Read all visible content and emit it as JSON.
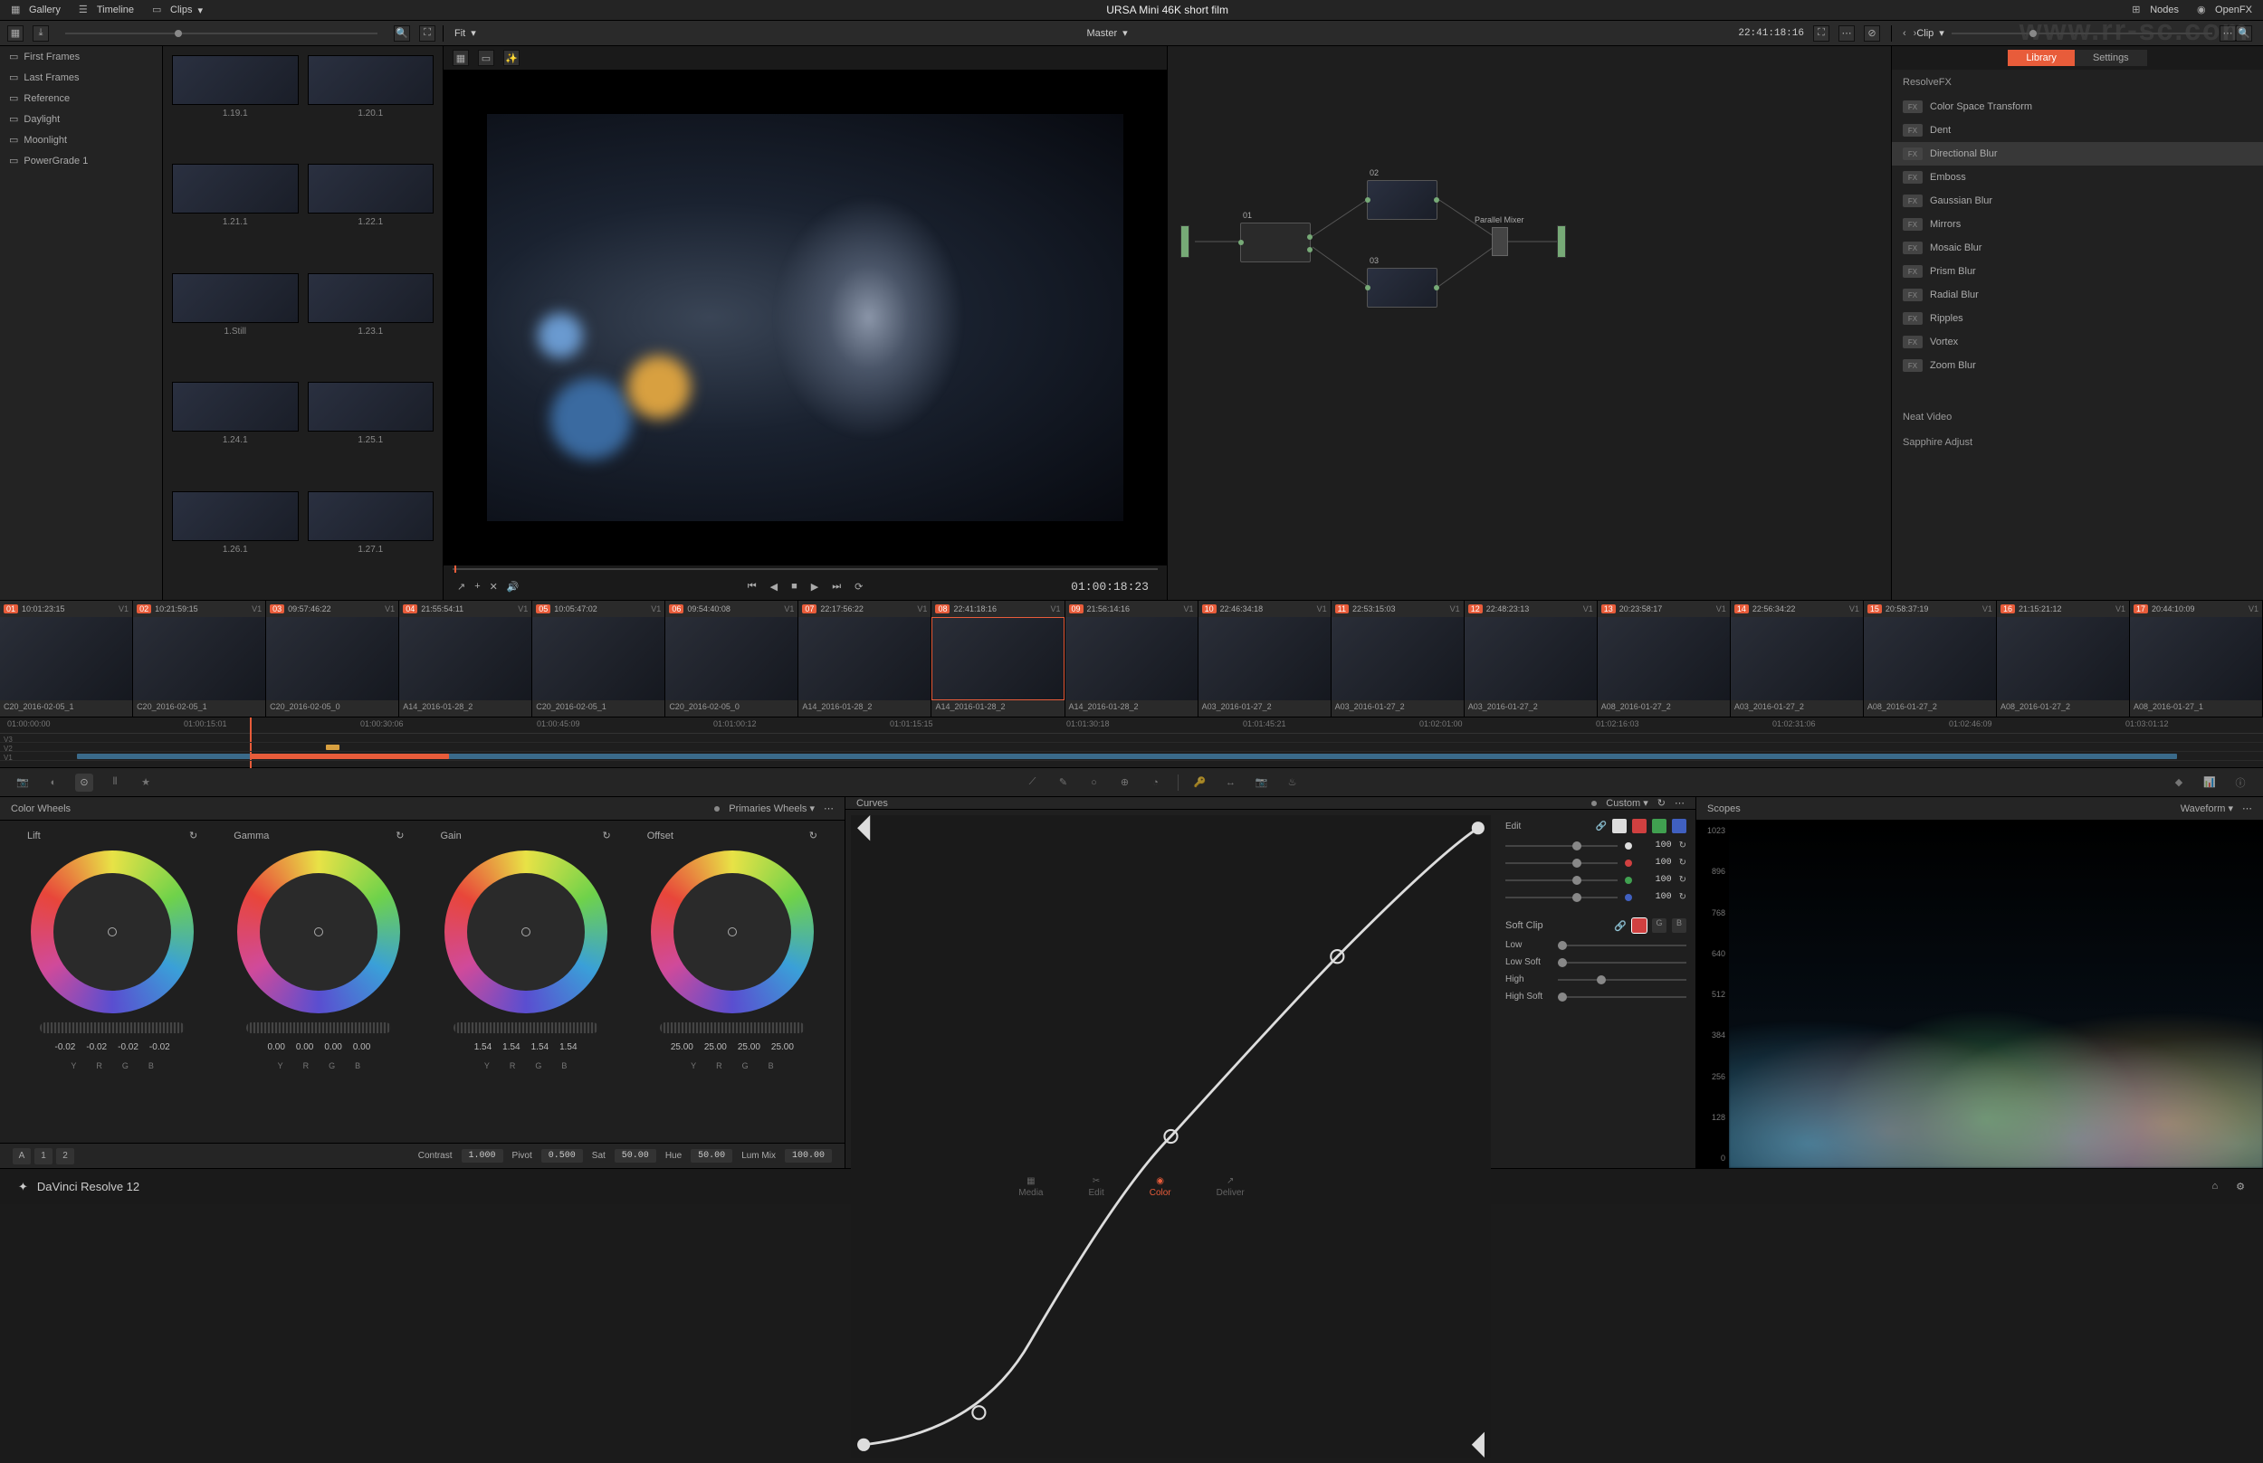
{
  "topbar": {
    "gallery": "Gallery",
    "timeline": "Timeline",
    "clips": "Clips",
    "title": "URSA Mini 46K short film",
    "nodes": "Nodes",
    "openfx": "OpenFX"
  },
  "subbar": {
    "fit": "Fit",
    "master": "Master",
    "viewerTC": "22:41:18:16",
    "clip": "Clip"
  },
  "galleryCats": [
    "First Frames",
    "Last Frames",
    "Reference",
    "Daylight",
    "Moonlight",
    "PowerGrade 1"
  ],
  "thumbs": [
    "1.19.1",
    "1.20.1",
    "1.21.1",
    "1.22.1",
    "1.Still",
    "1.23.1",
    "1.24.1",
    "1.25.1",
    "1.26.1",
    "1.27.1"
  ],
  "transportTC": "01:00:18:23",
  "nodes": {
    "n1": "01",
    "n2": "02",
    "n3": "03",
    "parallel": "Parallel Mixer"
  },
  "fx": {
    "library": "Library",
    "settings": "Settings",
    "hdr": "ResolveFX",
    "items": [
      "Color Space Transform",
      "Dent",
      "Directional Blur",
      "Emboss",
      "Gaussian Blur",
      "Mirrors",
      "Mosaic Blur",
      "Prism Blur",
      "Radial Blur",
      "Ripples",
      "Vortex",
      "Zoom Blur"
    ],
    "selectedIdx": 2,
    "neat": "Neat Video",
    "sapphire": "Sapphire Adjust"
  },
  "clips": [
    {
      "n": "01",
      "tc": "10:01:23:15",
      "v": "V1",
      "name": "C20_2016-02-05_1"
    },
    {
      "n": "02",
      "tc": "10:21:59:15",
      "v": "V1",
      "name": "C20_2016-02-05_1"
    },
    {
      "n": "03",
      "tc": "09:57:46:22",
      "v": "V1",
      "name": "C20_2016-02-05_0"
    },
    {
      "n": "04",
      "tc": "21:55:54:11",
      "v": "V1",
      "name": "A14_2016-01-28_2"
    },
    {
      "n": "05",
      "tc": "10:05:47:02",
      "v": "V1",
      "name": "C20_2016-02-05_1"
    },
    {
      "n": "06",
      "tc": "09:54:40:08",
      "v": "V1",
      "name": "C20_2016-02-05_0"
    },
    {
      "n": "07",
      "tc": "22:17:56:22",
      "v": "V1",
      "name": "A14_2016-01-28_2"
    },
    {
      "n": "08",
      "tc": "22:41:18:16",
      "v": "V1",
      "name": "A14_2016-01-28_2"
    },
    {
      "n": "09",
      "tc": "21:56:14:16",
      "v": "V1",
      "name": "A14_2016-01-28_2"
    },
    {
      "n": "10",
      "tc": "22:46:34:18",
      "v": "V1",
      "name": "A03_2016-01-27_2"
    },
    {
      "n": "11",
      "tc": "22:53:15:03",
      "v": "V1",
      "name": "A03_2016-01-27_2"
    },
    {
      "n": "12",
      "tc": "22:48:23:13",
      "v": "V1",
      "name": "A03_2016-01-27_2"
    },
    {
      "n": "13",
      "tc": "20:23:58:17",
      "v": "V1",
      "name": "A08_2016-01-27_2"
    },
    {
      "n": "14",
      "tc": "22:56:34:22",
      "v": "V1",
      "name": "A03_2016-01-27_2"
    },
    {
      "n": "15",
      "tc": "20:58:37:19",
      "v": "V1",
      "name": "A08_2016-01-27_2"
    },
    {
      "n": "16",
      "tc": "21:15:21:12",
      "v": "V1",
      "name": "A08_2016-01-27_2"
    },
    {
      "n": "17",
      "tc": "20:44:10:09",
      "v": "V1",
      "name": "A08_2016-01-27_1"
    }
  ],
  "activeClipIdx": 7,
  "miniRuler": [
    "01:00:00:00",
    "01:00:15:01",
    "01:00:30:06",
    "01:00:45:09",
    "01:01:00:12",
    "01:01:15:15",
    "01:01:30:18",
    "01:01:45:21",
    "01:02:01:00",
    "01:02:16:03",
    "01:02:31:06",
    "01:02:46:09",
    "01:03:01:12"
  ],
  "miniTracks": [
    "V3",
    "V2",
    "V1"
  ],
  "wheels": {
    "hdr": "Color Wheels",
    "mode": "Primaries Wheels",
    "cols": [
      {
        "t": "Lift",
        "vals": [
          "-0.02",
          "-0.02",
          "-0.02",
          "-0.02"
        ]
      },
      {
        "t": "Gamma",
        "vals": [
          "0.00",
          "0.00",
          "0.00",
          "0.00"
        ]
      },
      {
        "t": "Gain",
        "vals": [
          "1.54",
          "1.54",
          "1.54",
          "1.54"
        ]
      },
      {
        "t": "Offset",
        "vals": [
          "25.00",
          "25.00",
          "25.00",
          "25.00"
        ]
      }
    ],
    "chLabels": [
      "Y",
      "R",
      "G",
      "B"
    ],
    "ftr": {
      "contrast": "Contrast",
      "contrastV": "1.000",
      "pivot": "Pivot",
      "pivotV": "0.500",
      "sat": "Sat",
      "satV": "50.00",
      "hue": "Hue",
      "hueV": "50.00",
      "lummix": "Lum Mix",
      "lummixV": "100.00"
    },
    "ab": [
      "A",
      "1",
      "2"
    ]
  },
  "curves": {
    "hdr": "Curves",
    "mode": "Custom",
    "edit": "Edit",
    "vals": {
      "y": "100",
      "r": "100",
      "g": "100",
      "b": "100"
    },
    "softclip": "Soft Clip",
    "low": "Low",
    "lowsoft": "Low Soft",
    "high": "High",
    "highsoft": "High Soft"
  },
  "scopes": {
    "hdr": "Scopes",
    "mode": "Waveform",
    "scale": [
      "1023",
      "896",
      "768",
      "640",
      "512",
      "384",
      "256",
      "128",
      "0"
    ]
  },
  "pages": [
    "Media",
    "Edit",
    "Color",
    "Deliver"
  ],
  "activePageIdx": 2,
  "appName": "DaVinci Resolve 12",
  "watermark": "www.rr-sc.com"
}
